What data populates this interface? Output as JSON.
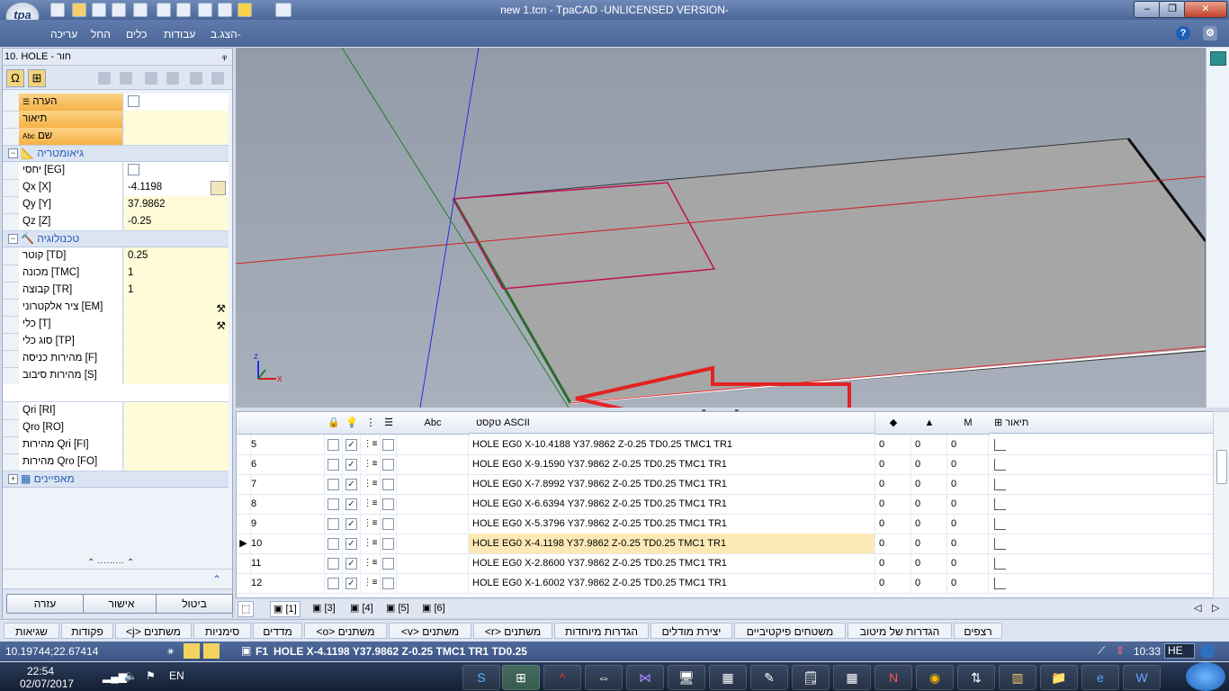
{
  "window": {
    "title": "new 1.tcn - TpaCAD -UNLICENSED VERSION-",
    "logo": "tpa",
    "controls": {
      "minimize": "–",
      "maximize": "❐",
      "close": "✕"
    }
  },
  "menu": {
    "items": [
      "עריכה",
      "החל",
      "כלים",
      "עבודות",
      "הצג.ב-"
    ],
    "help_icon": "?"
  },
  "left_panel": {
    "title": "10. HOLE - חור",
    "pin": "ᵩ",
    "tool_buttons": [
      "Ω",
      "⊞"
    ],
    "rows_top": [
      {
        "label": "הערה",
        "value": "",
        "type": "check"
      },
      {
        "label": "תיאור",
        "value": ""
      },
      {
        "label": "שם",
        "value": ""
      }
    ],
    "cat_geometry": "גיאומטריה",
    "rows_geometry": [
      {
        "label": "יחסי [EG]",
        "value": "",
        "type": "check"
      },
      {
        "label": "Qx [X]",
        "value": "-4.1198"
      },
      {
        "label": "Qy [Y]",
        "value": "37.9862"
      },
      {
        "label": "Qz [Z]",
        "value": "-0.25"
      }
    ],
    "cat_technology": "טכנולוגיה",
    "rows_technology": [
      {
        "label": "קוטר [TD]",
        "value": "0.25"
      },
      {
        "label": "מכונה [TMC]",
        "value": "1"
      },
      {
        "label": "קבוצה [TR]",
        "value": "1"
      },
      {
        "label": "ציר אלקטרוני [EM]",
        "value": ""
      },
      {
        "label": "כלי [T]",
        "value": ""
      },
      {
        "label": "סוג כלי [TP]",
        "value": ""
      },
      {
        "label": "מהירות כניסה [F]",
        "value": ""
      },
      {
        "label": "מהירות סיבוב [S]",
        "value": ""
      }
    ],
    "rows_q": [
      {
        "label": "Qri [RI]",
        "value": ""
      },
      {
        "label": "Qro [RO]",
        "value": ""
      },
      {
        "label": "מהירות Qri [FI]",
        "value": ""
      },
      {
        "label": "מהירות Qro [FO]",
        "value": ""
      }
    ],
    "cat_properties": "מאפיינים",
    "dots": "·········",
    "buttons": {
      "help": "עזרה",
      "ok": "אישור",
      "cancel": "ביטול"
    }
  },
  "grid": {
    "headers": {
      "text": "טקסט ASCII",
      "m": "M",
      "desc": "תיאור",
      "abc": "Abc"
    },
    "rows": [
      {
        "num": "5",
        "text": "HOLE EG0 X-10.4188 Y37.9862 Z-0.25 TD0.25 TMC1 TR1",
        "a": "0",
        "b": "0",
        "m": "0",
        "selected": false
      },
      {
        "num": "6",
        "text": "HOLE EG0 X-9.1590 Y37.9862 Z-0.25 TD0.25 TMC1 TR1",
        "a": "0",
        "b": "0",
        "m": "0",
        "selected": false
      },
      {
        "num": "7",
        "text": "HOLE EG0 X-7.8992 Y37.9862 Z-0.25 TD0.25 TMC1 TR1",
        "a": "0",
        "b": "0",
        "m": "0",
        "selected": false
      },
      {
        "num": "8",
        "text": "HOLE EG0 X-6.6394 Y37.9862 Z-0.25 TD0.25 TMC1 TR1",
        "a": "0",
        "b": "0",
        "m": "0",
        "selected": false
      },
      {
        "num": "9",
        "text": "HOLE EG0 X-5.3796 Y37.9862 Z-0.25 TD0.25 TMC1 TR1",
        "a": "0",
        "b": "0",
        "m": "0",
        "selected": false
      },
      {
        "num": "10",
        "text": "HOLE EG0 X-4.1198 Y37.9862 Z-0.25 TD0.25 TMC1 TR1",
        "a": "0",
        "b": "0",
        "m": "0",
        "selected": true
      },
      {
        "num": "11",
        "text": "HOLE EG0 X-2.8600 Y37.9862 Z-0.25 TD0.25 TMC1 TR1",
        "a": "0",
        "b": "0",
        "m": "0",
        "selected": false
      },
      {
        "num": "12",
        "text": "HOLE EG0 X-1.6002 Y37.9862 Z-0.25 TD0.25 TMC1 TR1",
        "a": "0",
        "b": "0",
        "m": "0",
        "selected": false
      }
    ]
  },
  "layer_tabs": [
    "[1]",
    "[3]",
    "[4]",
    "[5]",
    "[6]"
  ],
  "panel_tabs": [
    "רצפים",
    "הגדרות של מיטוב",
    "משטחים פיקטיביים",
    "יצירת מודלים",
    "הגדרות מיוחדות",
    "<r> משתנים",
    "<v> משתנים",
    "<o> משתנים",
    "מדדים",
    "סימניות",
    "<j> משתנים",
    "פקודות",
    "שגיאות"
  ],
  "status": {
    "coords": "10.19744;22.67414",
    "cmd_prefix": "F1",
    "cmd": "HOLE X-4.1198 Y37.9862 Z-0.25 TMC1 TR1 TD0.25",
    "time": "10:33",
    "lang": "HE"
  },
  "taskbar": {
    "time": "22:54",
    "date": "02/07/2017",
    "lang": "EN"
  },
  "colors": {
    "accent": "#4b6798",
    "selection": "#fde9b5",
    "arrow": "#e32222"
  }
}
